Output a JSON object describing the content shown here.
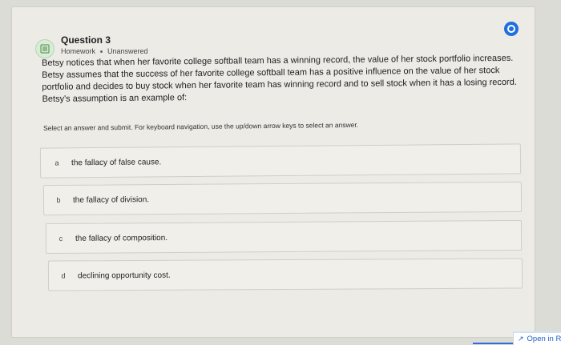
{
  "question": {
    "title": "Question 3",
    "type": "Homework",
    "status": "Unanswered",
    "text": "Betsy notices that when her favorite college softball team has a winning record, the value of her stock portfolio increases. Betsy assumes that the success of her favorite college softball team has a positive influence on the value of her stock portfolio and decides to buy stock when her favorite team has winning record and to sell stock when it has a losing record. Betsy's assumption is an example of:",
    "instructions": "Select an answer and submit. For keyboard navigation, use the up/down arrow keys to select an answer."
  },
  "options": [
    {
      "letter": "a",
      "label": "the fallacy of false cause."
    },
    {
      "letter": "b",
      "label": "the fallacy of division."
    },
    {
      "letter": "c",
      "label": "the fallacy of composition."
    },
    {
      "letter": "d",
      "label": "declining opportunity cost."
    }
  ],
  "footer": {
    "open_in": "Open in R"
  },
  "colors": {
    "accent": "#1e6fe0",
    "icon_bg": "#d8ecd6"
  }
}
